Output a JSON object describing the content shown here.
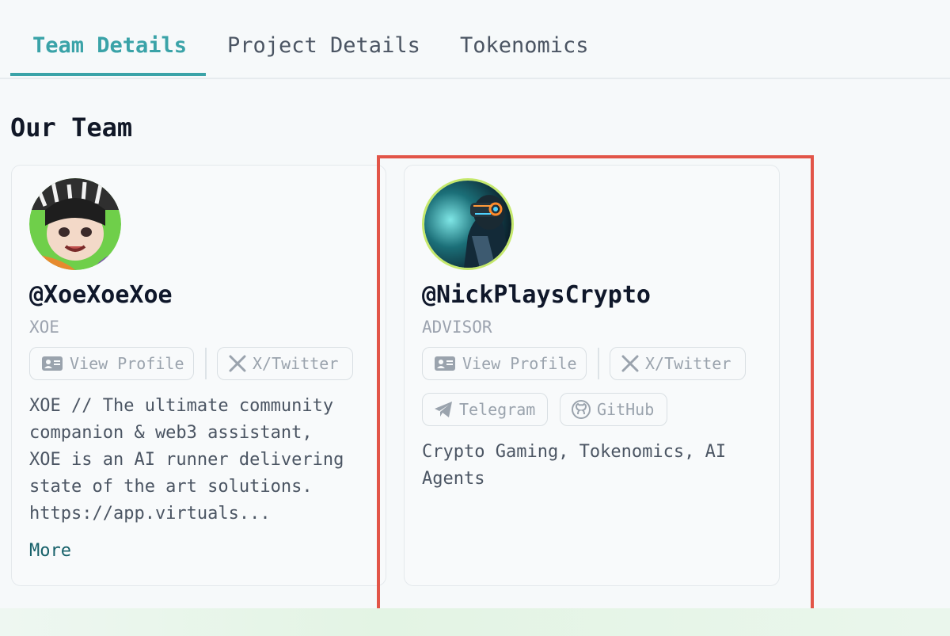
{
  "tabs": [
    {
      "label": "Team Details",
      "active": true
    },
    {
      "label": "Project Details",
      "active": false
    },
    {
      "label": "Tokenomics",
      "active": false
    }
  ],
  "section_title": "Our Team",
  "members": [
    {
      "handle": "@XoeXoeXoe",
      "role": "XOE",
      "buttons": {
        "view_profile": "View Profile",
        "twitter": "X/Twitter"
      },
      "description": "XOE // The ultimate community\ncompanion & web3 assistant,\nXOE is an AI runner delivering\nstate of the art solutions.\nhttps://app.virtuals...",
      "more": "More"
    },
    {
      "handle": "@NickPlaysCrypto",
      "role": "ADVISOR",
      "buttons": {
        "view_profile": "View Profile",
        "twitter": "X/Twitter",
        "telegram": "Telegram",
        "github": "GitHub"
      },
      "description": "Crypto Gaming, Tokenomics, AI\nAgents"
    }
  ],
  "colors": {
    "accent": "#3aa3a8",
    "highlight": "#e25548",
    "more_link": "#17616a"
  },
  "icons": [
    "id-card-icon",
    "x-logo-icon",
    "telegram-icon",
    "github-icon"
  ]
}
